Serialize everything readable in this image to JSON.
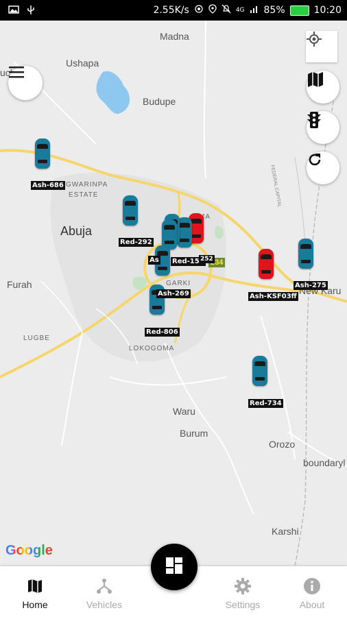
{
  "status": {
    "speed": "2.55K/s",
    "battery": "85%",
    "time": "10:20",
    "network": "4G"
  },
  "map": {
    "places": {
      "madna": "Madna",
      "ushapa": "Ushapa",
      "budupe": "Budupe",
      "uch": "uch",
      "gwarinpa": "GWARINPA",
      "estate": "ESTATE",
      "abuja": "Abuja",
      "furah": "Furah",
      "garki": "GARKI",
      "lugbe": "LUGBE",
      "lokogoma": "LOKOGOMA",
      "waru": "Waru",
      "burum": "Burum",
      "orozo": "Orozo",
      "boundary": "boundaryl",
      "karshi": "Karshi",
      "nyanyan": "New Karu",
      "maitama": "MA",
      "route": "234",
      "vertical_road": "FEDERAL CAPITAL"
    },
    "vehicles": [
      {
        "label": "Ash-686",
        "color": "blue"
      },
      {
        "label": "Red-292",
        "color": "blue"
      },
      {
        "label": "Red-155",
        "color": "blue"
      },
      {
        "label": "Ash-269",
        "color": "blue"
      },
      {
        "label": "Red-806",
        "color": "blue"
      },
      {
        "label": "Ash-KSF03ff",
        "color": "red"
      },
      {
        "label": "Ash-275",
        "color": "blue"
      },
      {
        "label": "Red-734",
        "color": "blue"
      },
      {
        "label": "As",
        "color": "blue"
      },
      {
        "label": "252",
        "color": "blue"
      }
    ],
    "google_logo": "Google"
  },
  "controls": {
    "menu_icon": "hamburger-menu-icon",
    "location_icon": "my-location-icon",
    "map_type_icon": "map-icon",
    "traffic_icon": "traffic-light-icon",
    "refresh_icon": "refresh-icon"
  },
  "nav": {
    "home": "Home",
    "vehicles": "Vehicles",
    "settings": "Settings",
    "about": "About"
  },
  "colors": {
    "primary": "#000000",
    "blue_vehicle": "#1a7a99",
    "red_vehicle": "#e0141c"
  }
}
